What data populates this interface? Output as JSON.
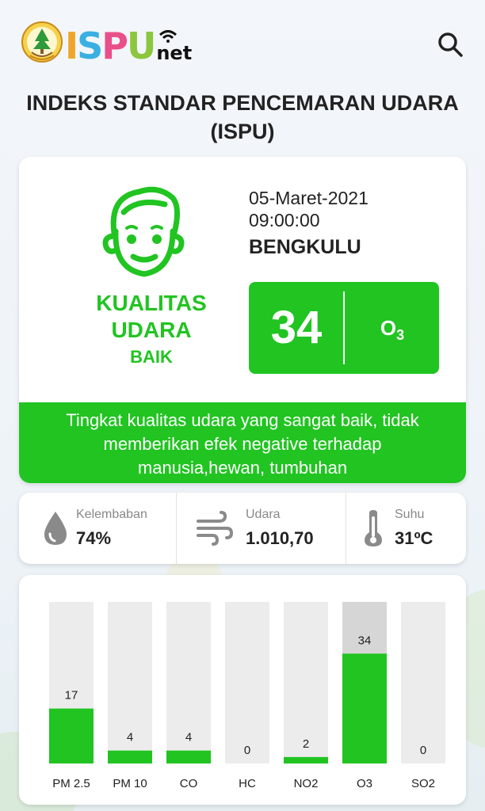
{
  "header": {
    "logo_letters": [
      "I",
      "S",
      "P",
      "U"
    ],
    "logo_letter_colors": [
      "#f0a52a",
      "#3ab0e2",
      "#e94f8a",
      "#8cc63f"
    ],
    "logo_suffix": "net"
  },
  "page_title": "INDEKS STANDAR PENCEMARAN UDARA (ISPU)",
  "status": {
    "quality_line1": "KUALITAS",
    "quality_line2": "UDARA",
    "quality_category": "BAIK",
    "date": "05-Maret-2021",
    "time": "09:00:00",
    "city": "BENGKULU",
    "index_value": "34",
    "dominant_param_main": "O",
    "dominant_param_sub": "3",
    "description": "Tingkat kualitas udara yang sangat baik, tidak memberikan efek negative terhadap manusia,hewan, tumbuhan",
    "accent_color": "#21c421"
  },
  "metrics": {
    "humidity_label": "Kelembaban",
    "humidity_value": "74%",
    "pressure_label": "Udara",
    "pressure_value": "1.010,70",
    "temperature_label": "Suhu",
    "temperature_value": "31ºC",
    "icons": [
      "water-drop-icon",
      "wind-icon",
      "thermometer-icon"
    ]
  },
  "chart_data": {
    "type": "bar",
    "categories": [
      "PM 2.5",
      "PM 10",
      "CO",
      "HC",
      "NO2",
      "O3",
      "SO2"
    ],
    "values": [
      17,
      4,
      4,
      0,
      2,
      34,
      0
    ],
    "ylim": [
      0,
      50
    ],
    "bar_color": "#21c421",
    "track_color": "#ececec",
    "highlight_track_color": "#d6d6d6",
    "highlight_category": "O3"
  }
}
